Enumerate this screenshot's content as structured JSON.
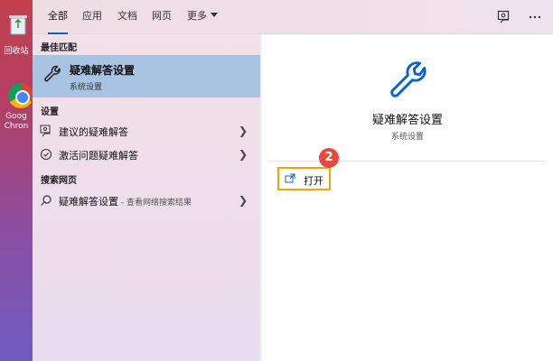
{
  "desktop": {
    "recycle_label": "回收站",
    "chrome_label_1": "Goog",
    "chrome_label_2": "Chron"
  },
  "tabs": [
    {
      "label": "全部"
    },
    {
      "label": "应用"
    },
    {
      "label": "文档"
    },
    {
      "label": "网页"
    },
    {
      "label": "更多"
    }
  ],
  "top_icons": [
    "feedback-icon",
    "more-icon"
  ],
  "left": {
    "best_match_header": "最佳匹配",
    "best_match": {
      "title": "疑难解答设置",
      "subtitle": "系统设置",
      "icon": "wrench-icon"
    },
    "settings_header": "设置",
    "settings_items": [
      {
        "label": "建议的疑难解答",
        "icon": "person-feedback-icon"
      },
      {
        "label": "激活问题疑难解答",
        "icon": "check-circle-icon"
      }
    ],
    "web_header": "搜索网页",
    "web_item": {
      "label": "疑难解答设置",
      "suffix": " - 查看网络搜索结果",
      "icon": "search-icon"
    }
  },
  "preview": {
    "title": "疑难解答设置",
    "subtitle": "系统设置",
    "open_label": "打开",
    "step_badge": "2"
  },
  "colors": {
    "accent": "#0b63c5",
    "selection": "#a9c3e3",
    "highlight_border": "#f0a500",
    "badge": "#e64a3c"
  }
}
